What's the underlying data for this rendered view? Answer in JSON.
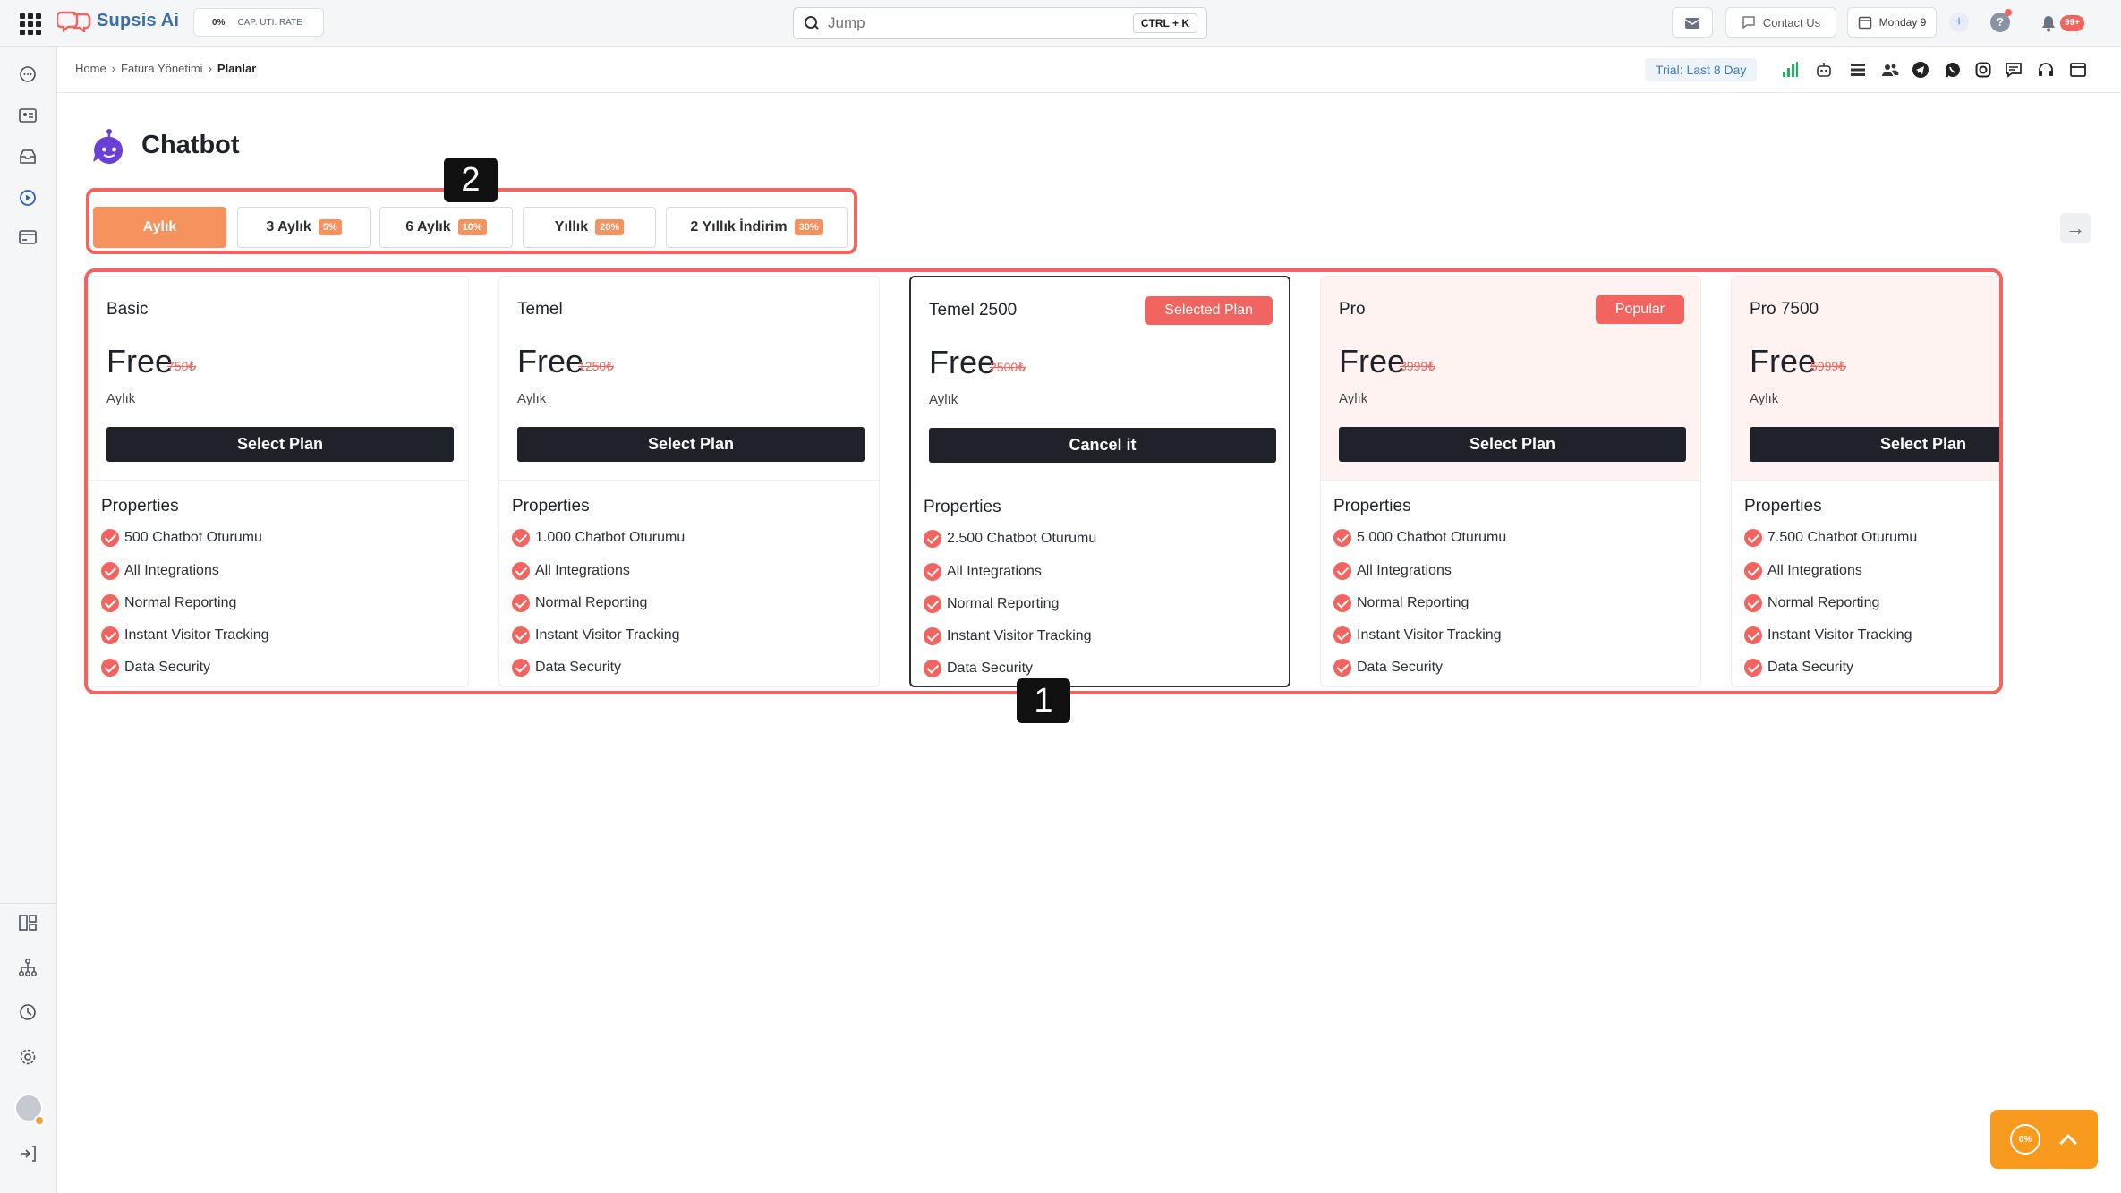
{
  "app": {
    "name": "Supsis Ai"
  },
  "topbar": {
    "cap_rate": {
      "value": "0%",
      "label": "CAP. UTI. RATE"
    },
    "search": {
      "placeholder": "Jump",
      "shortcut": "CTRL + K"
    },
    "contact_label": "Contact Us",
    "calendar_label": "Monday 9",
    "notifications_count": "99+"
  },
  "breadcrumb": {
    "items": [
      "Home",
      "Fatura Yönetimi",
      "Planlar"
    ]
  },
  "trial_label": "Trial: Last 8 Day",
  "page": {
    "title": "Chatbot"
  },
  "period_tabs": [
    {
      "label": "Aylık",
      "discount": "",
      "active": true
    },
    {
      "label": "3 Aylık",
      "discount": "5%"
    },
    {
      "label": "6 Aylık",
      "discount": "10%"
    },
    {
      "label": "Yıllık",
      "discount": "20%"
    },
    {
      "label": "2 Yıllık İndirim",
      "discount": "30%"
    }
  ],
  "callouts": {
    "tabs": "2",
    "plans": "1"
  },
  "plans": [
    {
      "name": "Basic",
      "badge": "",
      "price": "Free",
      "old_price": "750₺",
      "period": "Aylık",
      "button": "Select Plan",
      "properties_title": "Properties",
      "features": [
        "500 Chatbot Oturumu",
        "All Integrations",
        "Normal Reporting",
        "Instant Visitor Tracking",
        "Data Security"
      ]
    },
    {
      "name": "Temel",
      "badge": "",
      "price": "Free",
      "old_price": "1250₺",
      "period": "Aylık",
      "button": "Select Plan",
      "properties_title": "Properties",
      "features": [
        "1.000 Chatbot Oturumu",
        "All Integrations",
        "Normal Reporting",
        "Instant Visitor Tracking",
        "Data Security"
      ]
    },
    {
      "name": "Temel 2500",
      "badge": "Selected Plan",
      "price": "Free",
      "old_price": "2500₺",
      "period": "Aylık",
      "button": "Cancel it",
      "properties_title": "Properties",
      "selected": true,
      "features": [
        "2.500 Chatbot Oturumu",
        "All Integrations",
        "Normal Reporting",
        "Instant Visitor Tracking",
        "Data Security"
      ]
    },
    {
      "name": "Pro",
      "badge": "Popular",
      "price": "Free",
      "old_price": "3999₺",
      "period": "Aylık",
      "button": "Select Plan",
      "properties_title": "Properties",
      "features": [
        "5.000 Chatbot Oturumu",
        "All Integrations",
        "Normal Reporting",
        "Instant Visitor Tracking",
        "Data Security"
      ]
    },
    {
      "name": "Pro 7500",
      "badge": "",
      "price": "Free",
      "old_price": "5999₺",
      "period": "Aylık",
      "button": "Select Plan",
      "properties_title": "Properties",
      "features": [
        "7.500 Chatbot Oturumu",
        "All Integrations",
        "Normal Reporting",
        "Instant Visitor Tracking",
        "Data Security"
      ]
    }
  ],
  "widget": {
    "progress": "0%"
  },
  "colors": {
    "accent": "#f2645f",
    "tab_active": "#f5925e",
    "button_dark": "#1f2329",
    "widget": "#f79a1e"
  }
}
